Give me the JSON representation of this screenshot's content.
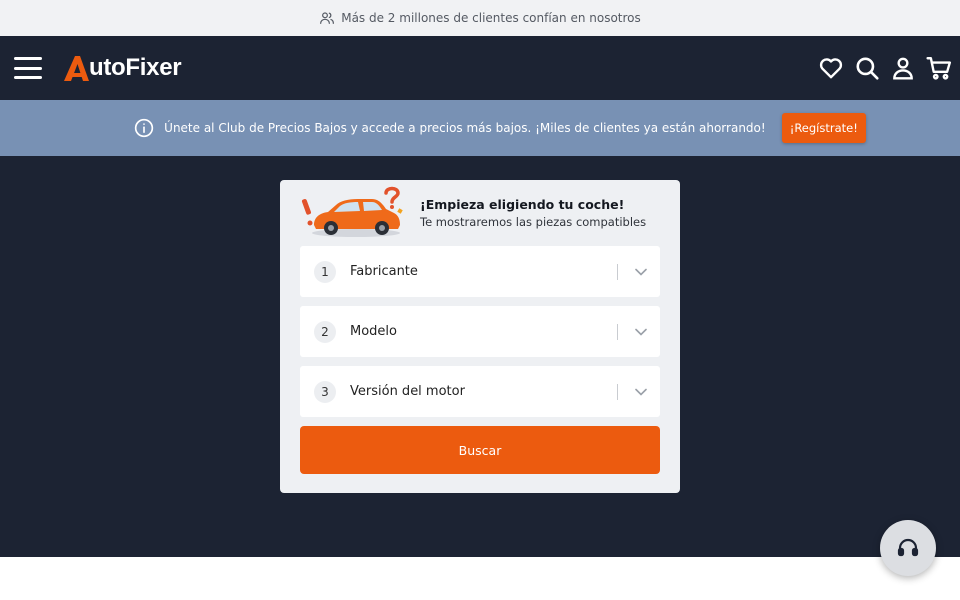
{
  "topbar": {
    "text": "Más de 2 millones de clientes confían en nosotros",
    "icon": "users-icon"
  },
  "header": {
    "logo_letter": "A",
    "logo_text": "utoFixer",
    "icons": [
      "menu-icon",
      "heart-icon",
      "search-icon",
      "user-icon",
      "cart-icon"
    ]
  },
  "promo": {
    "text": "Únete al Club de Precios Bajos y accede a precios más bajos. ¡Miles de clientes ya están ahorrando!",
    "button": "¡Regístrate!"
  },
  "selector": {
    "title": "¡Empieza eligiendo tu coche!",
    "subtitle": "Te mostraremos las piezas compatibles",
    "fields": [
      {
        "num": "1",
        "label": "Fabricante"
      },
      {
        "num": "2",
        "label": "Modelo"
      },
      {
        "num": "3",
        "label": "Versión del motor"
      }
    ],
    "button": "Buscar"
  },
  "colors": {
    "brand": "#ec5b0f",
    "dark": "#1c2333",
    "promo_bg": "#7891b4"
  }
}
